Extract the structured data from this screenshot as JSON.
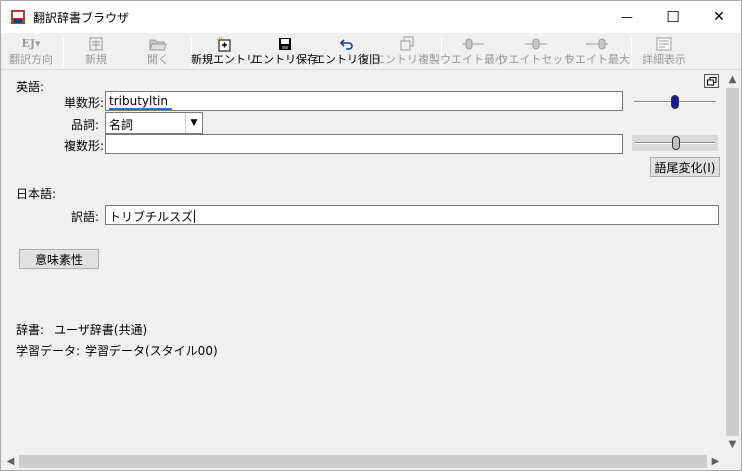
{
  "window": {
    "title": "翻訳辞書ブラウザ",
    "minimize_glyph": "—",
    "maximize_glyph": "☐",
    "close_glyph": "✕"
  },
  "toolbar": {
    "items": [
      {
        "label": "翻訳方向",
        "icon": "translation-direction-icon",
        "icon_text": "EJ▾",
        "enabled": false
      },
      {
        "label": "新規",
        "icon": "new-icon",
        "enabled": false
      },
      {
        "label": "開く",
        "icon": "open-folder-icon",
        "enabled": false
      },
      {
        "label": "新規エントリ",
        "icon": "new-entry-icon",
        "enabled": true
      },
      {
        "label": "エントリ保存",
        "icon": "save-disk-icon",
        "enabled": true
      },
      {
        "label": "エントリ復旧",
        "icon": "undo-icon",
        "enabled": true
      },
      {
        "label": "エントリ複製",
        "icon": "duplicate-icon",
        "enabled": false
      },
      {
        "label": "ウエイト最小",
        "icon": "weight-min-icon",
        "enabled": false
      },
      {
        "label": "ウエイトセット",
        "icon": "weight-set-icon",
        "enabled": false
      },
      {
        "label": "ウエイト最大",
        "icon": "weight-max-icon",
        "enabled": false
      },
      {
        "label": "詳細表示",
        "icon": "detail-view-icon",
        "enabled": false
      }
    ]
  },
  "english": {
    "section_label": "英語:",
    "singular_label": "単数形:",
    "singular_value": "tributyltin",
    "pos_label": "品詞:",
    "pos_value": "名詞",
    "plural_label": "複数形:",
    "plural_value": "",
    "inflection_button": "語尾変化(I)"
  },
  "japanese": {
    "section_label": "日本語:",
    "translation_label": "訳語:",
    "translation_value": "トリブチルスズ"
  },
  "semantic_button": "意味素性",
  "info": {
    "dictionary_label": "辞書:",
    "dictionary_value": "ユーザ辞書(共通)",
    "learning_label": "学習データ:",
    "learning_value": "学習データ(スタイル00)"
  },
  "colors": {
    "accent_underline": "#2a6fd6",
    "slider_thumb_top": "#1a1aa0",
    "slider_thumb_bottom": "#c0c0c0"
  }
}
